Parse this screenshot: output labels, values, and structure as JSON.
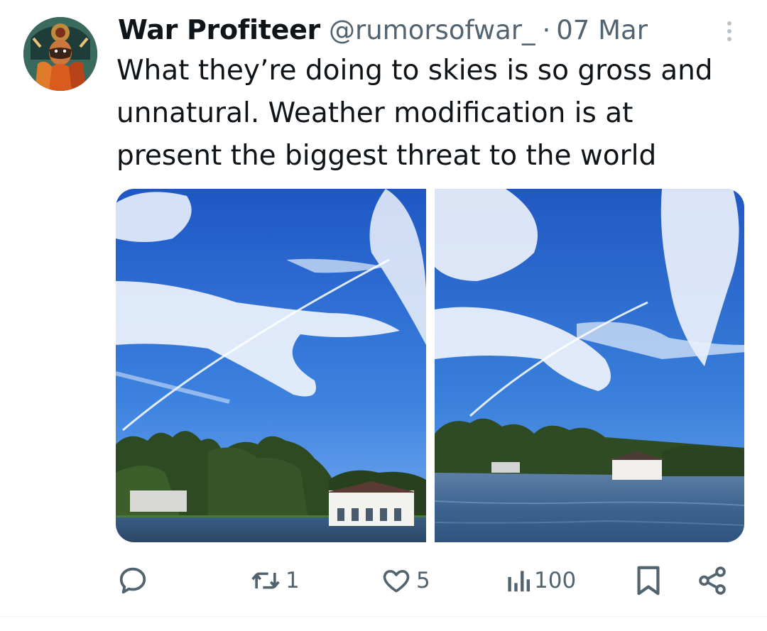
{
  "tweet": {
    "display_name": "War Profiteer",
    "handle": "@rumorsofwar_",
    "separator": "·",
    "date": "07 Mar",
    "text": "What they’re doing to skies is so gross and unnatural. Weather modification is at present the biggest threat to the world"
  },
  "media": {
    "photos": [
      {
        "subject": "blue sky with contrail and clouds above a lake with trees and white house"
      },
      {
        "subject": "blue sky with contrail and streaked clouds above a lake shoreline"
      }
    ]
  },
  "actions": {
    "reply_icon": "reply-icon",
    "retweet_icon": "retweet-icon",
    "retweet_count": "1",
    "like_icon": "heart-icon",
    "like_count": "5",
    "views_icon": "views-icon",
    "views_count": "100",
    "bookmark_icon": "bookmark-icon",
    "share_icon": "share-icon"
  },
  "colors": {
    "text": "#0f1419",
    "secondary": "#536471",
    "sky": "#2f6fd6"
  }
}
